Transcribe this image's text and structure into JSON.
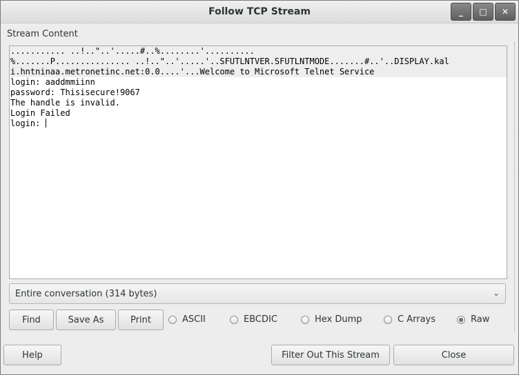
{
  "window": {
    "title": "Follow TCP Stream",
    "controls": {
      "minimize": "_",
      "maximize": "□",
      "close": "✕"
    }
  },
  "stream": {
    "label": "Stream Content",
    "lines": [
      "........... ..!..\"..'.....#..%........'..........",
      "%.......P............... ..!..\"..'.....'..SFUTLNTVER.SFUTLNTMODE.......#..'..DISPLAY.kal",
      "i.hntninaa.metronetinc.net:0.0....'...Welcome to Microsoft Telnet Service",
      "",
      "login: aaddmmiinn",
      "",
      "password: Thisisecure!9067",
      "",
      "The handle is invalid.",
      "",
      "Login Failed",
      "",
      "login: "
    ]
  },
  "conversation_select": {
    "value": "Entire conversation (314 bytes)"
  },
  "buttons": {
    "find": "Find",
    "save_as": "Save As",
    "print": "Print",
    "help": "Help",
    "filter_out": "Filter Out This Stream",
    "close": "Close"
  },
  "format_options": {
    "ascii": "ASCII",
    "ebcdic": "EBCDIC",
    "hex_dump": "Hex Dump",
    "c_arrays": "C Arrays",
    "raw": "Raw",
    "selected": "Raw"
  }
}
